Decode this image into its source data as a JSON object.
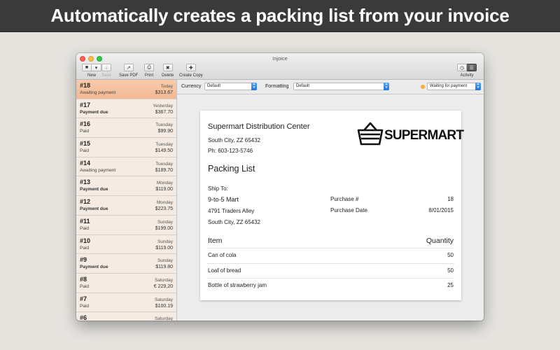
{
  "banner": {
    "headline": "Automatically creates a packing list from your invoice"
  },
  "window": {
    "title": "Injoice"
  },
  "toolbar": {
    "new_label": "New",
    "save_label": "Save",
    "save_pdf_label": "Save PDF",
    "print_label": "Print",
    "delete_label": "Delete",
    "create_copy_label": "Create Copy",
    "activity_label": "Activity"
  },
  "filters": {
    "currency_label": "Currency",
    "currency_value": "Default",
    "formatting_label": "Formatting",
    "formatting_value": "Default",
    "status_value": "Waiting for payment",
    "status_color": "#f4b32e"
  },
  "invoices": [
    {
      "number": "#18",
      "day": "Today",
      "status": "Awaiting payment",
      "amount": "$313.67",
      "due": false,
      "selected": true
    },
    {
      "number": "#17",
      "day": "Yesterday",
      "status": "Payment due",
      "amount": "$367.70",
      "due": true
    },
    {
      "number": "#16",
      "day": "Tuesday",
      "status": "Paid",
      "amount": "$99.90",
      "due": false
    },
    {
      "number": "#15",
      "day": "Tuesday",
      "status": "Paid",
      "amount": "$149.50",
      "due": false
    },
    {
      "number": "#14",
      "day": "Tuesday",
      "status": "Awaiting payment",
      "amount": "$189.70",
      "due": false
    },
    {
      "number": "#13",
      "day": "Monday",
      "status": "Payment due",
      "amount": "$119.00",
      "due": true
    },
    {
      "number": "#12",
      "day": "Monday",
      "status": "Payment due",
      "amount": "$223.75",
      "due": true
    },
    {
      "number": "#11",
      "day": "Sunday",
      "status": "Paid",
      "amount": "$199.00",
      "due": false
    },
    {
      "number": "#10",
      "day": "Sunday",
      "status": "Paid",
      "amount": "$119.00",
      "due": false
    },
    {
      "number": "#9",
      "day": "Sunday",
      "status": "Payment due",
      "amount": "$119.80",
      "due": true
    },
    {
      "number": "#8",
      "day": "Saturday",
      "status": "Paid",
      "amount": "€ 229,20",
      "due": false
    },
    {
      "number": "#7",
      "day": "Saturday",
      "status": "Paid",
      "amount": "$100.19",
      "due": false
    },
    {
      "number": "#6",
      "day": "Saturday",
      "status": "",
      "amount": "",
      "due": false
    }
  ],
  "document": {
    "company_name": "Supermart Distribution Center",
    "company_city": "South City, ZZ 65432",
    "company_phone": "Ph: 603-123-5746",
    "logo_text": "SUPERMART",
    "title": "Packing List",
    "ship_to_label": "Ship To:",
    "ship_name": "9-to-5 Mart",
    "ship_street": "4791 Traders Alley",
    "ship_city": "South City, ZZ 65432",
    "purchase_no_label": "Purchase #",
    "purchase_no": "18",
    "purchase_date_label": "Purchase Date",
    "purchase_date": "8/01/2015",
    "item_header": "Item",
    "qty_header": "Quantity",
    "items": [
      {
        "name": "Can of cola",
        "qty": "50"
      },
      {
        "name": "Loaf of bread",
        "qty": "50"
      },
      {
        "name": "Bottle of strawberry jam",
        "qty": "25"
      }
    ]
  }
}
